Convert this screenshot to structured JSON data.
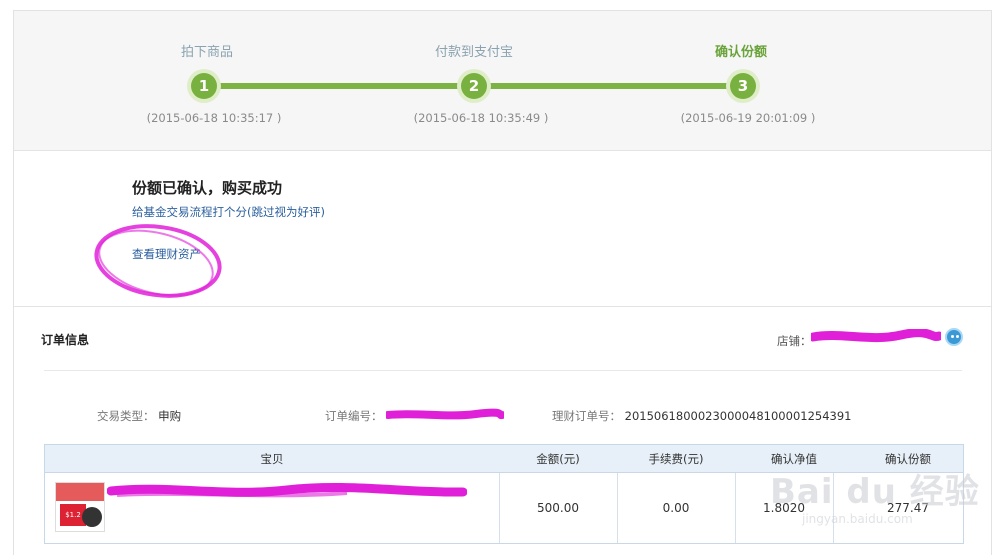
{
  "steps": [
    {
      "num": "1",
      "label": "拍下商品",
      "time": "(2015-06-18 10:35:17 )"
    },
    {
      "num": "2",
      "label": "付款到支付宝",
      "time": "(2015-06-18 10:35:49 )"
    },
    {
      "num": "3",
      "label": "确认份额",
      "time": "(2015-06-19 20:01:09 )"
    }
  ],
  "success": {
    "title": "份额已确认，购买成功",
    "rate_link": "给基金交易流程打个分(跳过视为好评)",
    "view_assets": "查看理财资产"
  },
  "order": {
    "title": "订单信息",
    "shop_label": "店铺：",
    "trade_type_label": "交易类型：",
    "trade_type_value": "申购",
    "order_no_label": "订单编号：",
    "finance_no_label": "理财订单号：",
    "finance_no_value": "2015061800023000048100001254391"
  },
  "table": {
    "headers": [
      "宝贝",
      "金额(元)",
      "手续费(元)",
      "确认净值",
      "确认份额"
    ],
    "row": {
      "amount": "500.00",
      "fee": "0.00",
      "nav": "1.8020",
      "shares": "277.47"
    }
  },
  "watermark": {
    "main": "Bai du 经验",
    "sub": "jingyan.baidu.com"
  },
  "colors": {
    "accent_green": "#78b13f",
    "link_blue": "#2a5f9e",
    "redaction": "#e020d8"
  }
}
